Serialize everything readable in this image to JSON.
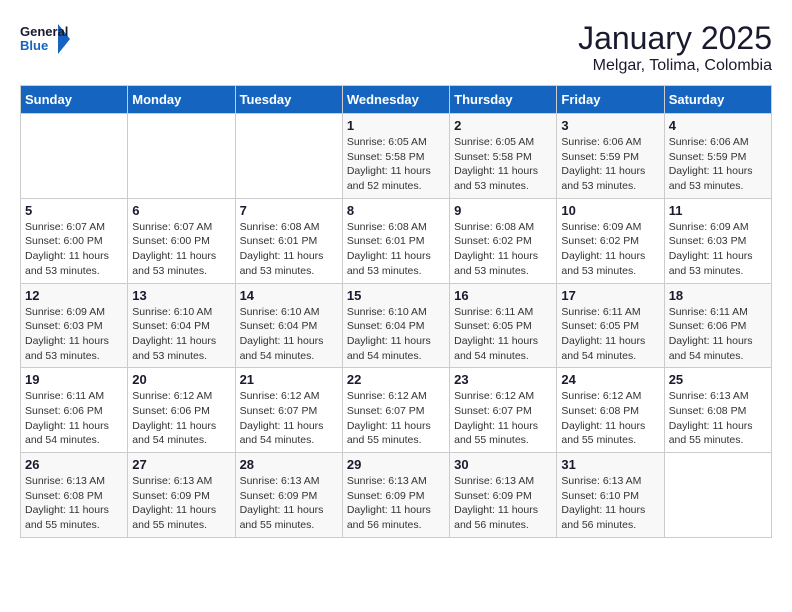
{
  "header": {
    "logo_general": "General",
    "logo_blue": "Blue",
    "month_title": "January 2025",
    "location": "Melgar, Tolima, Colombia"
  },
  "days_of_week": [
    "Sunday",
    "Monday",
    "Tuesday",
    "Wednesday",
    "Thursday",
    "Friday",
    "Saturday"
  ],
  "weeks": [
    [
      {
        "num": "",
        "info": ""
      },
      {
        "num": "",
        "info": ""
      },
      {
        "num": "",
        "info": ""
      },
      {
        "num": "1",
        "info": "Sunrise: 6:05 AM\nSunset: 5:58 PM\nDaylight: 11 hours\nand 52 minutes."
      },
      {
        "num": "2",
        "info": "Sunrise: 6:05 AM\nSunset: 5:58 PM\nDaylight: 11 hours\nand 53 minutes."
      },
      {
        "num": "3",
        "info": "Sunrise: 6:06 AM\nSunset: 5:59 PM\nDaylight: 11 hours\nand 53 minutes."
      },
      {
        "num": "4",
        "info": "Sunrise: 6:06 AM\nSunset: 5:59 PM\nDaylight: 11 hours\nand 53 minutes."
      }
    ],
    [
      {
        "num": "5",
        "info": "Sunrise: 6:07 AM\nSunset: 6:00 PM\nDaylight: 11 hours\nand 53 minutes."
      },
      {
        "num": "6",
        "info": "Sunrise: 6:07 AM\nSunset: 6:00 PM\nDaylight: 11 hours\nand 53 minutes."
      },
      {
        "num": "7",
        "info": "Sunrise: 6:08 AM\nSunset: 6:01 PM\nDaylight: 11 hours\nand 53 minutes."
      },
      {
        "num": "8",
        "info": "Sunrise: 6:08 AM\nSunset: 6:01 PM\nDaylight: 11 hours\nand 53 minutes."
      },
      {
        "num": "9",
        "info": "Sunrise: 6:08 AM\nSunset: 6:02 PM\nDaylight: 11 hours\nand 53 minutes."
      },
      {
        "num": "10",
        "info": "Sunrise: 6:09 AM\nSunset: 6:02 PM\nDaylight: 11 hours\nand 53 minutes."
      },
      {
        "num": "11",
        "info": "Sunrise: 6:09 AM\nSunset: 6:03 PM\nDaylight: 11 hours\nand 53 minutes."
      }
    ],
    [
      {
        "num": "12",
        "info": "Sunrise: 6:09 AM\nSunset: 6:03 PM\nDaylight: 11 hours\nand 53 minutes."
      },
      {
        "num": "13",
        "info": "Sunrise: 6:10 AM\nSunset: 6:04 PM\nDaylight: 11 hours\nand 53 minutes."
      },
      {
        "num": "14",
        "info": "Sunrise: 6:10 AM\nSunset: 6:04 PM\nDaylight: 11 hours\nand 54 minutes."
      },
      {
        "num": "15",
        "info": "Sunrise: 6:10 AM\nSunset: 6:04 PM\nDaylight: 11 hours\nand 54 minutes."
      },
      {
        "num": "16",
        "info": "Sunrise: 6:11 AM\nSunset: 6:05 PM\nDaylight: 11 hours\nand 54 minutes."
      },
      {
        "num": "17",
        "info": "Sunrise: 6:11 AM\nSunset: 6:05 PM\nDaylight: 11 hours\nand 54 minutes."
      },
      {
        "num": "18",
        "info": "Sunrise: 6:11 AM\nSunset: 6:06 PM\nDaylight: 11 hours\nand 54 minutes."
      }
    ],
    [
      {
        "num": "19",
        "info": "Sunrise: 6:11 AM\nSunset: 6:06 PM\nDaylight: 11 hours\nand 54 minutes."
      },
      {
        "num": "20",
        "info": "Sunrise: 6:12 AM\nSunset: 6:06 PM\nDaylight: 11 hours\nand 54 minutes."
      },
      {
        "num": "21",
        "info": "Sunrise: 6:12 AM\nSunset: 6:07 PM\nDaylight: 11 hours\nand 54 minutes."
      },
      {
        "num": "22",
        "info": "Sunrise: 6:12 AM\nSunset: 6:07 PM\nDaylight: 11 hours\nand 55 minutes."
      },
      {
        "num": "23",
        "info": "Sunrise: 6:12 AM\nSunset: 6:07 PM\nDaylight: 11 hours\nand 55 minutes."
      },
      {
        "num": "24",
        "info": "Sunrise: 6:12 AM\nSunset: 6:08 PM\nDaylight: 11 hours\nand 55 minutes."
      },
      {
        "num": "25",
        "info": "Sunrise: 6:13 AM\nSunset: 6:08 PM\nDaylight: 11 hours\nand 55 minutes."
      }
    ],
    [
      {
        "num": "26",
        "info": "Sunrise: 6:13 AM\nSunset: 6:08 PM\nDaylight: 11 hours\nand 55 minutes."
      },
      {
        "num": "27",
        "info": "Sunrise: 6:13 AM\nSunset: 6:09 PM\nDaylight: 11 hours\nand 55 minutes."
      },
      {
        "num": "28",
        "info": "Sunrise: 6:13 AM\nSunset: 6:09 PM\nDaylight: 11 hours\nand 55 minutes."
      },
      {
        "num": "29",
        "info": "Sunrise: 6:13 AM\nSunset: 6:09 PM\nDaylight: 11 hours\nand 56 minutes."
      },
      {
        "num": "30",
        "info": "Sunrise: 6:13 AM\nSunset: 6:09 PM\nDaylight: 11 hours\nand 56 minutes."
      },
      {
        "num": "31",
        "info": "Sunrise: 6:13 AM\nSunset: 6:10 PM\nDaylight: 11 hours\nand 56 minutes."
      },
      {
        "num": "",
        "info": ""
      }
    ]
  ]
}
